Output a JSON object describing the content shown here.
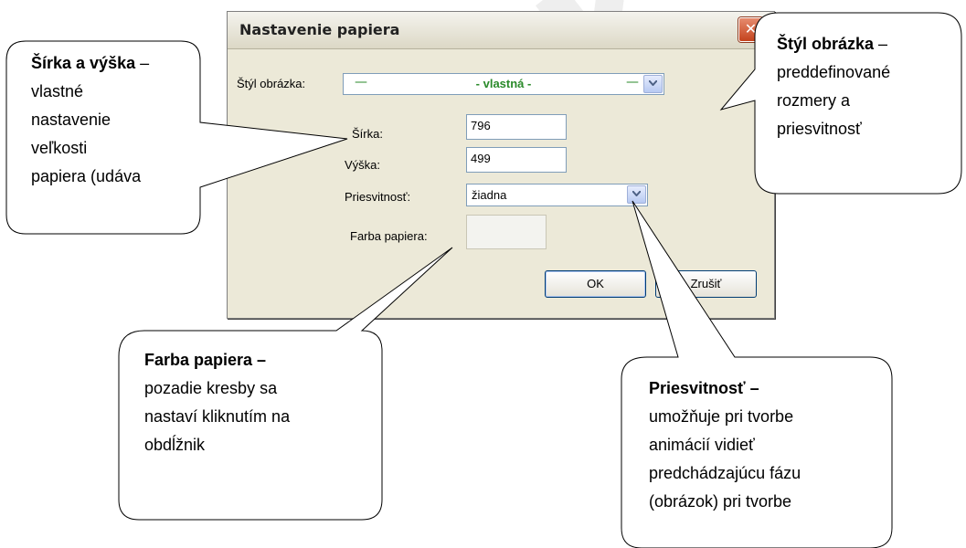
{
  "watermark": "..SK",
  "dialog": {
    "title": "Nastavenie papiera",
    "close_icon": "close-x-icon",
    "style_label": "Štýl obrázka:",
    "style_dash_left": "—",
    "style_value": "- vlastná -",
    "style_dash_right": "—",
    "width_label": "Šírka:",
    "width_value": "796",
    "height_label": "Výška:",
    "height_value": "499",
    "transparency_label": "Priesvitnosť:",
    "transparency_value": "žiadna",
    "paper_color_label": "Farba papiera:",
    "ok_label": "OK",
    "cancel_label": "Zrušiť"
  },
  "callouts": {
    "size": {
      "title": "Šírka a výška",
      "dash": " –",
      "lines": [
        "vlastné",
        "nastavenie",
        "veľkosti",
        "papiera (udáva"
      ]
    },
    "style": {
      "title": "Štýl obrázka",
      "dash": " –",
      "lines": [
        "preddefinované",
        "rozmery a",
        "priesvitnosť"
      ]
    },
    "color": {
      "title": "Farba papiera –",
      "lines": [
        "pozadie kresby sa",
        "nastaví kliknutím na",
        "obdĺžnik"
      ]
    },
    "transparency": {
      "title": "Priesvitnosť –",
      "lines": [
        "umožňuje pri tvorbe",
        "animácií vidieť",
        "predchádzajúcu fázu",
        "(obrázok) pri tvorbe"
      ]
    }
  },
  "colors": {
    "style_text": "#2a8a2a",
    "dialog_bg": "#ece9d8",
    "close_button": "#c4431d"
  }
}
